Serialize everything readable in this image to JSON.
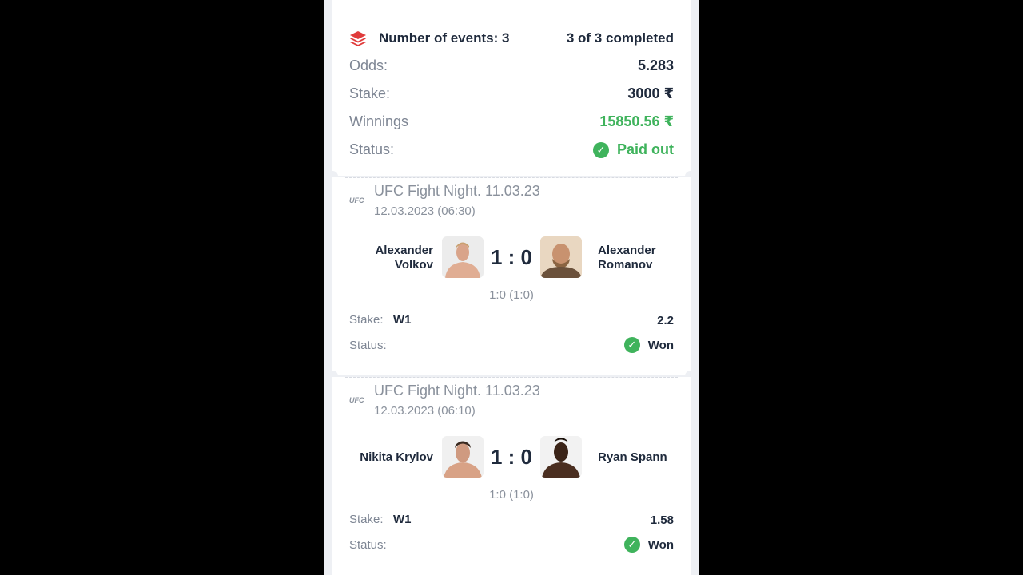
{
  "summary": {
    "events_label": "Number of events: 3",
    "completed_label": "3 of 3 completed",
    "odds_label": "Odds:",
    "odds_value": "5.283",
    "stake_label": "Stake:",
    "stake_value": "3000 ₹",
    "winnings_label": "Winnings",
    "winnings_value": "15850.56 ₹",
    "status_label": "Status:",
    "status_value": "Paid out",
    "layers_icon": "layers-icon",
    "accent_color": "#e03b3b",
    "success_color": "#3fb35c"
  },
  "events": [
    {
      "logo": "UFC",
      "title": "UFC Fight Night. 11.03.23",
      "datetime": "12.03.2023 (06:30)",
      "fighter1_line1": "Alexander",
      "fighter1_line2": "Volkov",
      "fighter2_line1": "Alexander",
      "fighter2_line2": "Romanov",
      "score": "1 : 0",
      "sub_score": "1:0 (1:0)",
      "stake_label": "Stake:",
      "stake_pick": "W1",
      "odds": "2.2",
      "status_label": "Status:",
      "status_value": "Won"
    },
    {
      "logo": "UFC",
      "title": "UFC Fight Night. 11.03.23",
      "datetime": "12.03.2023 (06:10)",
      "fighter1": "Nikita Krylov",
      "fighter2": "Ryan Spann",
      "score": "1 : 0",
      "sub_score": "1:0 (1:0)",
      "stake_label": "Stake:",
      "stake_pick": "W1",
      "odds": "1.58",
      "status_label": "Status:",
      "status_value": "Won"
    }
  ]
}
